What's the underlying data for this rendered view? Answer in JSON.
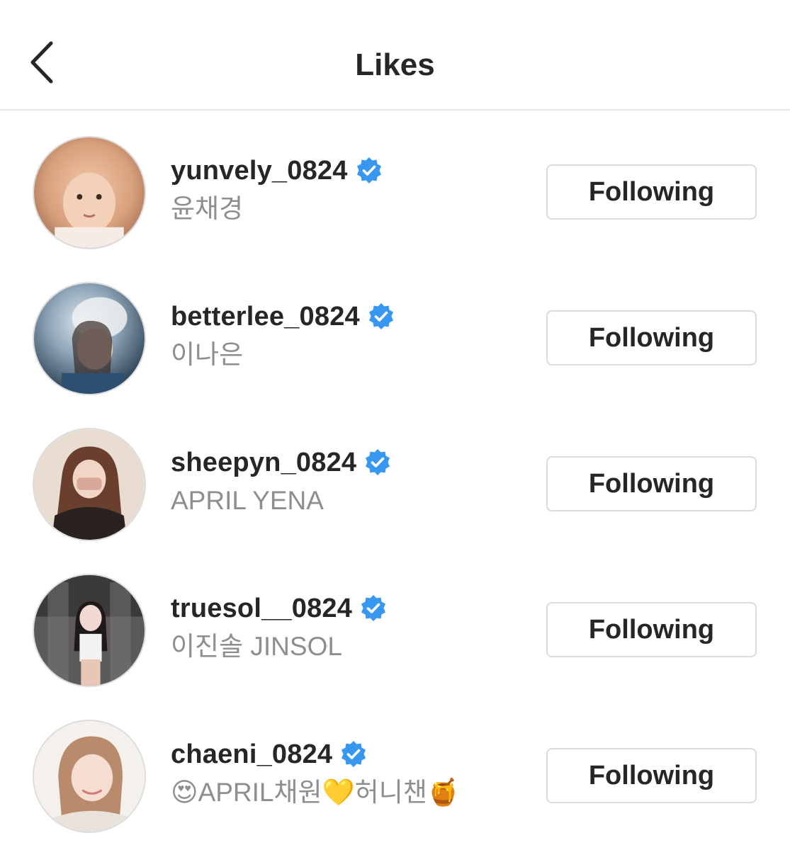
{
  "header": {
    "title": "Likes",
    "back_icon": "chevron-left-icon"
  },
  "colors": {
    "verified_badge": "#3897f0",
    "secondary_text": "#8e8e8e",
    "button_border": "#dbdbdb"
  },
  "users": [
    {
      "username": "yunvely_0824",
      "full_name": "윤채경",
      "verified": true,
      "button_label": "Following"
    },
    {
      "username": "betterlee_0824",
      "full_name": "이나은",
      "verified": true,
      "button_label": "Following"
    },
    {
      "username": "sheepyn_0824",
      "full_name": "APRIL YENA",
      "verified": true,
      "button_label": "Following"
    },
    {
      "username": "truesol__0824",
      "full_name": "이진솔 JINSOL",
      "verified": true,
      "button_label": "Following"
    },
    {
      "username": "chaeni_0824",
      "full_name": "😍APRIL채원💛허니챈🍯",
      "verified": true,
      "button_label": "Following"
    }
  ]
}
